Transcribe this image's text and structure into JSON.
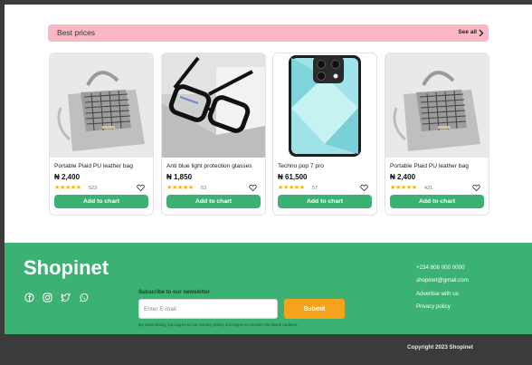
{
  "banner": {
    "title": "Best prices",
    "see_all": "See all",
    "color": "#fbb7c4"
  },
  "products": [
    {
      "name": "Portable Plaid PU leather bag",
      "price": "₦ 2,400",
      "rating": 5,
      "reviews": "523",
      "cta": "Add to chart",
      "image": "plaid-bag"
    },
    {
      "name": "Anti blue light protection glasses",
      "price": "₦ 1,850",
      "rating": 5,
      "reviews": "63",
      "cta": "Add to chart",
      "image": "eyeglasses"
    },
    {
      "name": "Techno pop 7 pro",
      "price": "₦ 61,500",
      "rating": 5,
      "reviews": "57",
      "cta": "Add to chart",
      "image": "smartphone"
    },
    {
      "name": "Portable Plaid PU leather bag",
      "price": "₦ 2,400",
      "rating": 5,
      "reviews": "421",
      "cta": "Add to chart",
      "image": "plaid-bag"
    }
  ],
  "footer": {
    "brand": "Shopinet",
    "socials": [
      "facebook-icon",
      "instagram-icon",
      "twitter-icon",
      "whatsapp-icon"
    ],
    "newsletter_label": "Subscribe to our newsletter",
    "email_placeholder": "Enter E-mail",
    "submit_label": "Submit",
    "disclaimer": "By subscribing, you agree to our privacy policy and agree to receive the latest updates.",
    "contact": [
      "+234 808 000 0000",
      "shopinet@gmail.com",
      "Advertise with us",
      "Privacy policy"
    ],
    "copyright": "Copyright 2023 Shopinet"
  },
  "colors": {
    "accent_green": "#3bb273",
    "submit_orange": "#f5a21c",
    "star": "#f5b301",
    "dark": "#3b3b3b"
  }
}
